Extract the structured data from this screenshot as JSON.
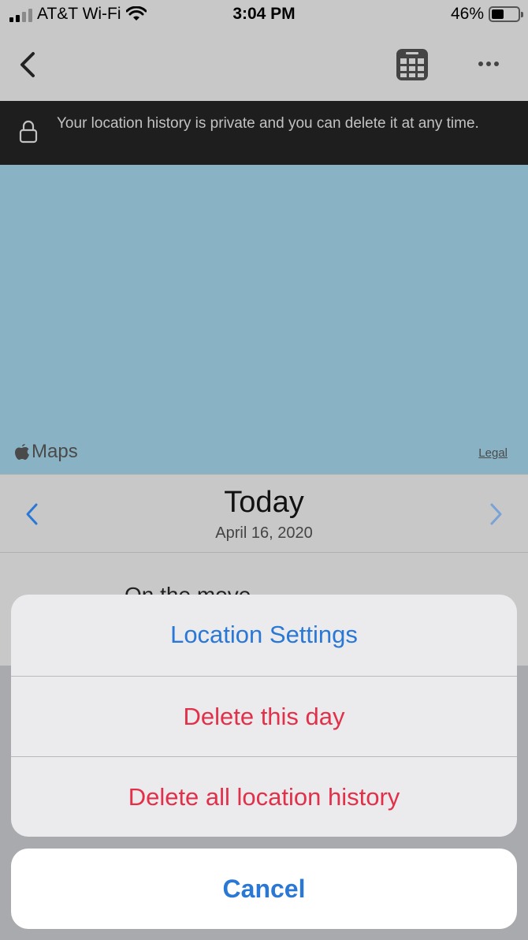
{
  "status_bar": {
    "carrier": "AT&T Wi-Fi",
    "time": "3:04 PM",
    "battery_percent_label": "46%",
    "battery_level": 0.46,
    "icons": [
      "signal-icon",
      "wifi-icon",
      "battery-icon"
    ]
  },
  "nav": {
    "icons": [
      "back-chevron-icon",
      "calendar-grid-icon",
      "more-dots-icon"
    ]
  },
  "privacy_banner": {
    "text": "Your location history is private and you can delete it at any time.",
    "icon": "lock-icon"
  },
  "map": {
    "logo_text": "Maps",
    "legal_label": "Legal",
    "background_color": "#89b3c4"
  },
  "day": {
    "title": "Today",
    "date": "April 16, 2020",
    "icons": [
      "chevron-left-icon",
      "chevron-right-icon"
    ]
  },
  "timeline": {
    "partial_item": "On the move"
  },
  "action_sheet": {
    "actions": [
      {
        "label": "Location Settings",
        "color": "#2a78d6"
      },
      {
        "label": "Delete this day",
        "color": "#e3304a"
      },
      {
        "label": "Delete all location history",
        "color": "#e3304a"
      }
    ],
    "cancel_label": "Cancel"
  }
}
